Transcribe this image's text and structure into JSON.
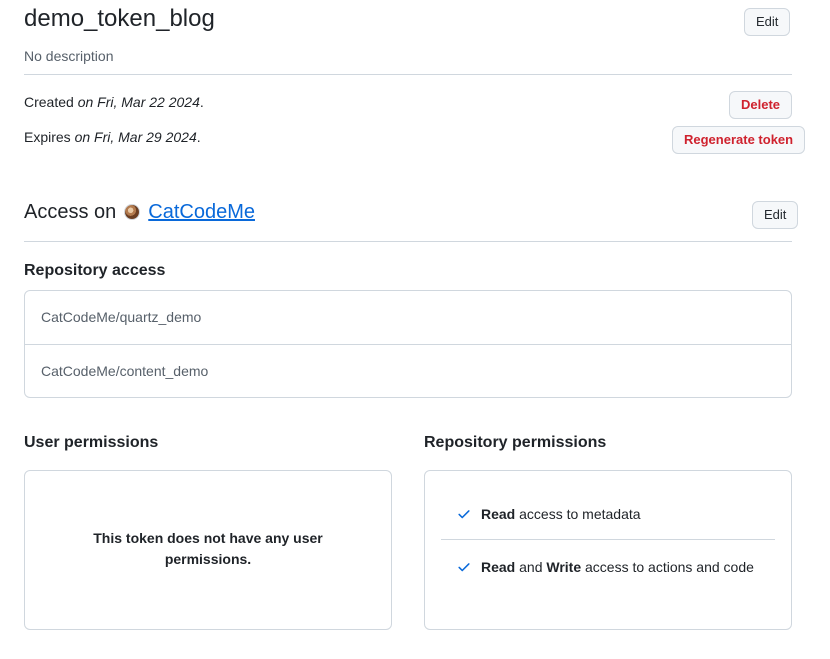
{
  "token": {
    "name": "demo_token_blog",
    "description": "No description",
    "edit_label": "Edit",
    "created_prefix": "Created",
    "created_value": "on Fri, Mar 22 2024",
    "expires_prefix": "Expires",
    "expires_value": "on Fri, Mar 29 2024",
    "period": ".",
    "delete_label": "Delete",
    "regenerate_label": "Regenerate token"
  },
  "access": {
    "prefix": "Access on",
    "org_name": "CatCodeMe",
    "edit_label": "Edit"
  },
  "repository_access": {
    "label": "Repository access",
    "repos": [
      "CatCodeMe/quartz_demo",
      "CatCodeMe/content_demo"
    ]
  },
  "user_permissions": {
    "label": "User permissions",
    "empty_message": "This token does not have any user permissions."
  },
  "repository_permissions": {
    "label": "Repository permissions",
    "items": [
      {
        "level": "Read",
        "connector": "",
        "level2": "",
        "rest": "access to metadata"
      },
      {
        "level": "Read",
        "connector": "and",
        "level2": "Write",
        "rest": "access to actions and code"
      }
    ]
  },
  "colors": {
    "link": "#0969da",
    "danger": "#cf222e",
    "check": "#0969da",
    "border": "#d0d7de"
  }
}
